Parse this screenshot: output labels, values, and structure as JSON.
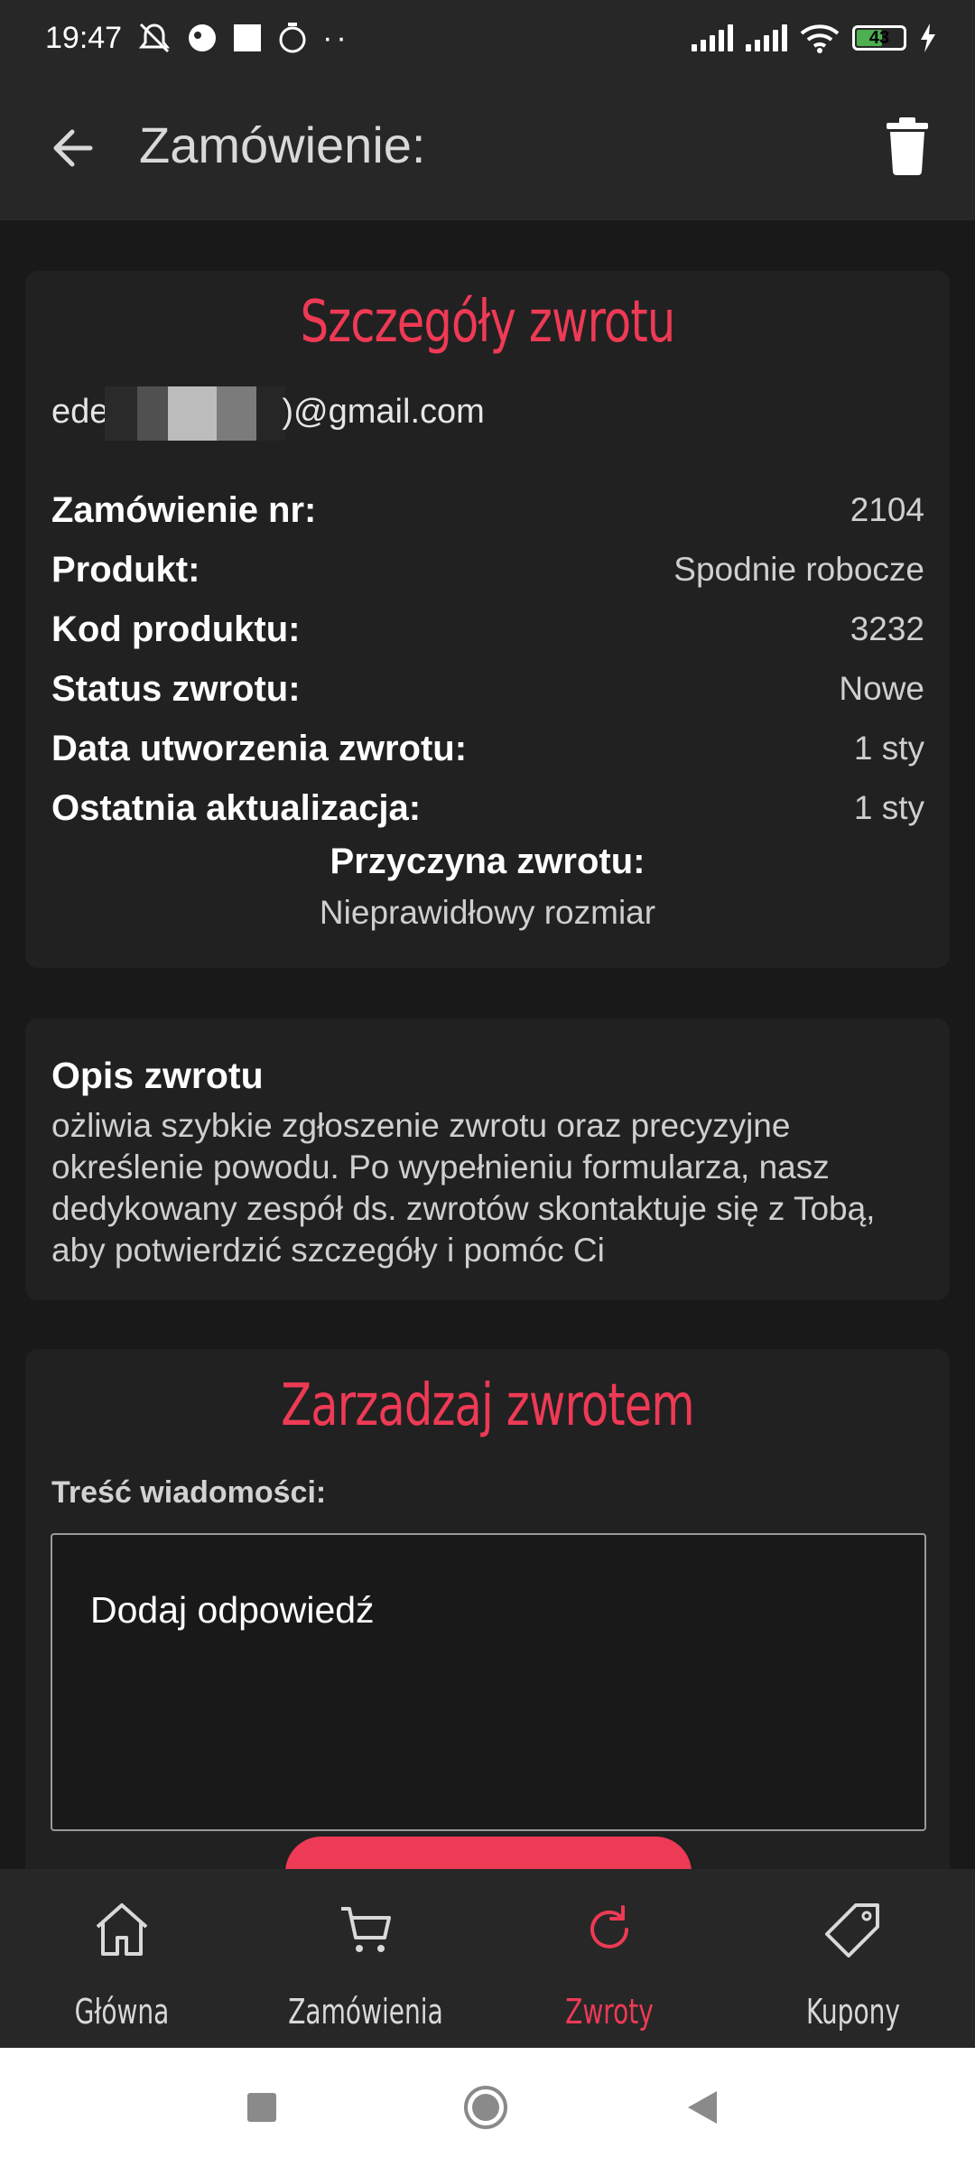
{
  "status_bar": {
    "time": "19:47",
    "battery": "43"
  },
  "header": {
    "title": "Zamówienie:"
  },
  "details": {
    "heading": "Szczegóły zwrotu",
    "email_prefix": "ede",
    "email_suffix": ")@gmail.com",
    "rows": [
      {
        "label": "Zamówienie nr:",
        "value": "2104"
      },
      {
        "label": "Produkt:",
        "value": "Spodnie robocze"
      },
      {
        "label": "Kod produktu:",
        "value": "3232"
      },
      {
        "label": "Status zwrotu:",
        "value": "Nowe"
      },
      {
        "label": "Data utworzenia zwrotu:",
        "value": "1 sty"
      },
      {
        "label": "Ostatnia aktualizacja:",
        "value": "1 sty"
      }
    ],
    "reason_label": "Przyczyna zwrotu:",
    "reason_value": "Nieprawidłowy rozmiar"
  },
  "description": {
    "title": "Opis zwrotu",
    "text": "ożliwia szybkie zgłoszenie zwrotu oraz precyzyjne określenie powodu. Po wypełnieniu formularza, nasz dedykowany zespół ds. zwrotów skontaktuje się z Tobą, aby potwierdzić szczegóły i pomóc Ci"
  },
  "manage": {
    "heading": "Zarzadzaj zwrotem",
    "message_label": "Treść wiadomości:",
    "message_placeholder": "Dodaj odpowiedź"
  },
  "bottom_nav": {
    "items": [
      {
        "label": "Główna",
        "icon": "home-icon"
      },
      {
        "label": "Zamówienia",
        "icon": "cart-icon"
      },
      {
        "label": "Zwroty",
        "icon": "refresh-icon",
        "active": true
      },
      {
        "label": "Kupony",
        "icon": "tag-icon"
      }
    ]
  },
  "colors": {
    "accent": "#ee3a55",
    "background": "#191919",
    "card": "#212121",
    "bar": "#272727"
  }
}
